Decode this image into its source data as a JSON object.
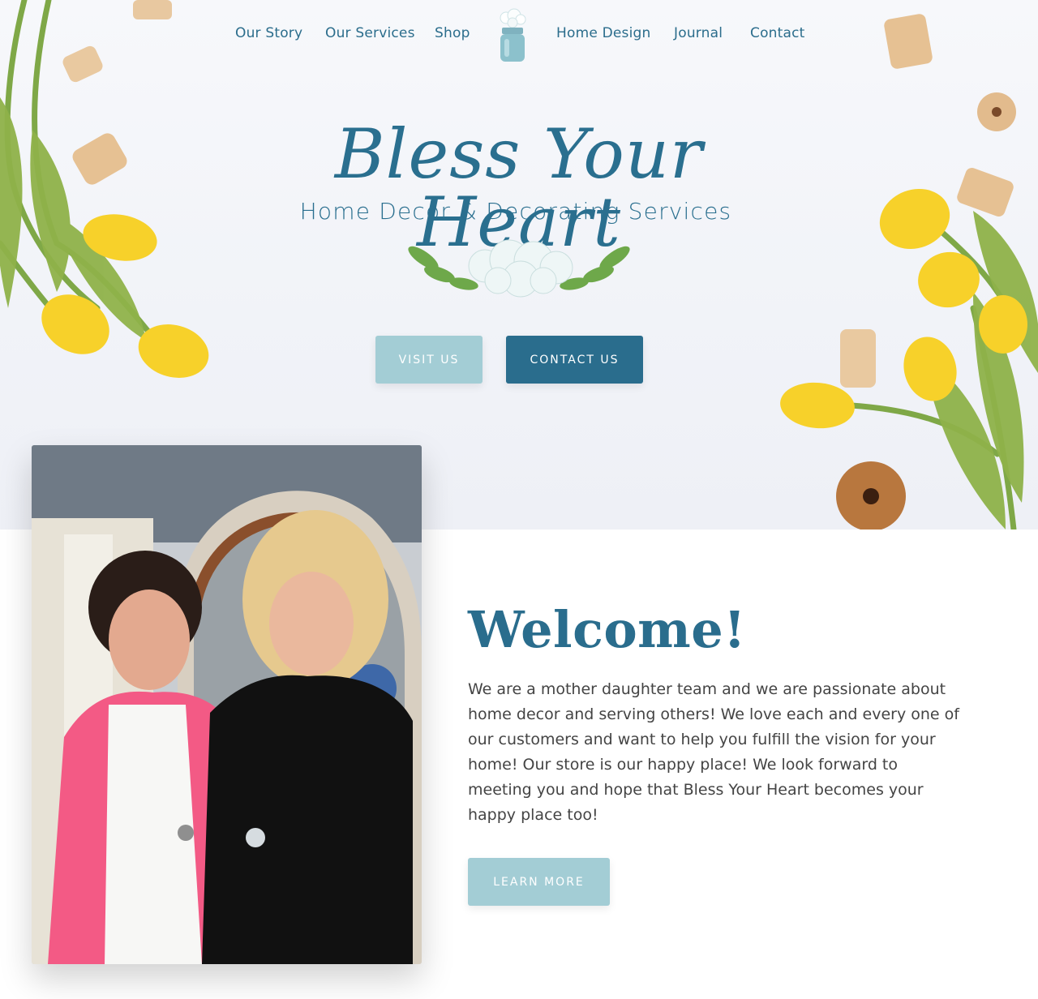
{
  "nav": {
    "left": [
      "Our Story",
      "Our Services",
      "Shop"
    ],
    "right": [
      "Home Design",
      "Journal",
      "Contact"
    ],
    "logo_icon": "mason-jar-icon"
  },
  "hero": {
    "brand_script": "Bless Your Heart",
    "brand_sub": "Home Decor & Decorating Services",
    "visit_label": "VISIT US",
    "contact_label": "CONTACT US"
  },
  "welcome": {
    "title": "Welcome!",
    "body": "We are a mother daughter team and we are passionate about home decor and serving others! We love each and every one of our customers and want to help you fulfill the vision for your home! Our store is our happy place! We look forward to meeting you and hope that Bless Your Heart becomes your happy place too!",
    "button_label": "LEARN MORE"
  },
  "colors": {
    "brand_blue": "#2a6d8d",
    "light_blue": "#a3cdd5",
    "text": "#444444"
  }
}
